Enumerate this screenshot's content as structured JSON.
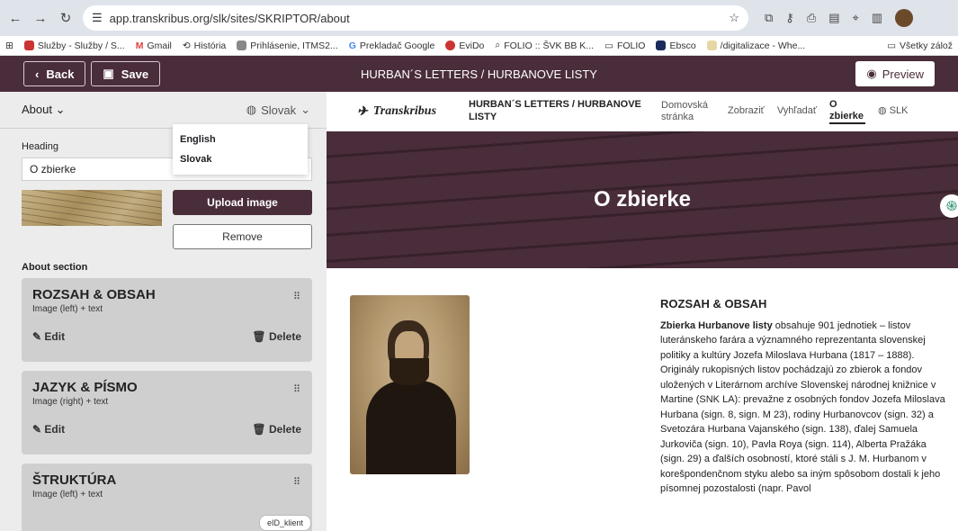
{
  "browser": {
    "url": "app.transkribus.org/slk/sites/SKRIPTOR/about",
    "bookmarks": [
      "Služby - Služby / S...",
      "Gmail",
      "História",
      "Prihlásenie, ITMS2...",
      "Prekladač Google",
      "EviDo",
      "FOLIO :: ŠVK BB K...",
      "FOLIO",
      "Ebsco",
      "/digitalizace - Whe..."
    ],
    "bookmarks_right": "Všetky zálož",
    "colors": {
      "chrome": "#dfe3ea",
      "brand": "#4a2d3a"
    }
  },
  "header": {
    "back": "Back",
    "save": "Save",
    "title": "HURBAN´S LETTERS / HURBANOVE LISTY",
    "preview": "Preview"
  },
  "editor": {
    "page_select": "About",
    "language": "Slovak",
    "dropdown": [
      "English",
      "Slovak"
    ],
    "heading_label": "Heading",
    "heading_value": "O zbierke",
    "upload": "Upload image",
    "remove": "Remove",
    "section_label": "About section",
    "sections": [
      {
        "title": "ROZSAH & OBSAH",
        "type": "Image (left) + text"
      },
      {
        "title": "JAZYK & PÍSMO",
        "type": "Image (right) + text"
      },
      {
        "title": "ŠTRUKTÚRA",
        "type": "Image (left) + text"
      }
    ],
    "edit": "Edit",
    "delete": "Delete",
    "tooltip": "eID_klient"
  },
  "site": {
    "logo": "Transkribus",
    "title": "HURBAN´S LETTERS / HURBANOVE LISTY",
    "nav": [
      "Domovská stránka",
      "Zobraziť",
      "Vyhľadať",
      "O zbierke",
      "SLK"
    ],
    "hero": "O zbierke",
    "article_title": "ROZSAH & OBSAH",
    "article_bold": "Zbierka Hurbanove listy",
    "article_text": " obsahuje 901 jednotiek – listov luteránskeho farára a významného reprezentanta slovenskej politiky a kultúry Jozefa Miloslava Hurbana (1817 – 1888). Originály rukopisných listov pochádzajú zo zbierok a fondov uložených v Literárnom archíve Slovenskej národnej knižnice v Martine (SNK LA): prevažne z osobných fondov Jozefa Miloslava Hurbana (sign. 8, sign. M 23), rodiny Hurbanovcov (sign. 32) a Svetozára Hurbana Vajanského (sign. 138), ďalej Samuela Jurkoviča (sign. 10), Pavla Roya (sign. 114), Alberta Pražáka (sign. 29) a ďalších osobností, ktoré stáli s J. M. Hurbanom v korešpondenčnom styku alebo sa iným spôsobom dostali k jeho písomnej pozostalosti (napr. Pavol"
  }
}
